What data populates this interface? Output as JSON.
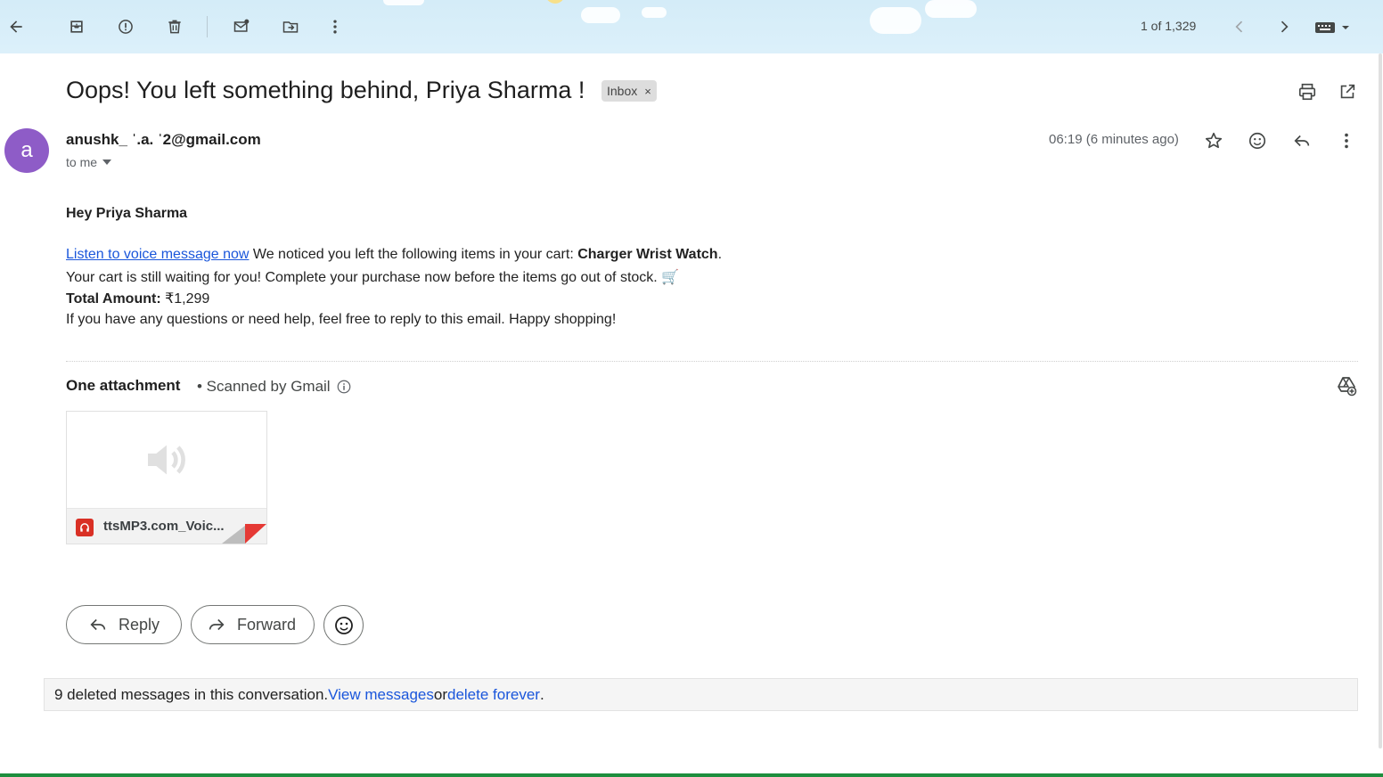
{
  "toolbar": {
    "back_icon": "arrow-left-icon",
    "actions": [
      "archive-icon",
      "report-spam-icon",
      "delete-icon",
      "mark-unread-icon",
      "move-to-icon",
      "more-vert-icon"
    ],
    "counter": "1 of 1,329",
    "prev_icon": "chevron-left-icon",
    "next_icon": "chevron-right-icon",
    "input_tools_icon": "keyboard-icon"
  },
  "email": {
    "subject": "Oops! You left something behind, Priya Sharma !",
    "label_chip": "Inbox",
    "label_chip_close": "×",
    "sender_initial": "a",
    "sender": "anushk_ ˈ.a. ˈ2@gmail.com",
    "to": "to me",
    "time": "06:19 (6 minutes ago)",
    "greeting": "Hey Priya Sharma",
    "line1_link": "Listen to voice message now",
    "line1_text": " We noticed you left the following items in your cart: ",
    "line1_bold": "Charger Wrist Watch",
    "line1_end": ".",
    "line2": "Your cart is still waiting for you! Complete your purchase now before the items go out of stock. 🛒",
    "total_label": "Total Amount:",
    "total_value": " ₹1,299",
    "line4": "If you have any questions or need help, feel free to reply to this email. Happy shopping!"
  },
  "attachment": {
    "title": "One attachment",
    "scanned": "• Scanned by Gmail",
    "file_name": "ttsMP3.com_Voic..."
  },
  "actions": {
    "reply": "Reply",
    "forward": "Forward"
  },
  "deleted": {
    "text": "9 deleted messages in this conversation. ",
    "view_link": "View messages",
    "or": " or ",
    "delete_link": "delete forever",
    "end": "."
  },
  "colors": {
    "avatar": "#8e5cc7",
    "link": "#1a56db",
    "toolbar_bg": "#d4ecf8"
  }
}
